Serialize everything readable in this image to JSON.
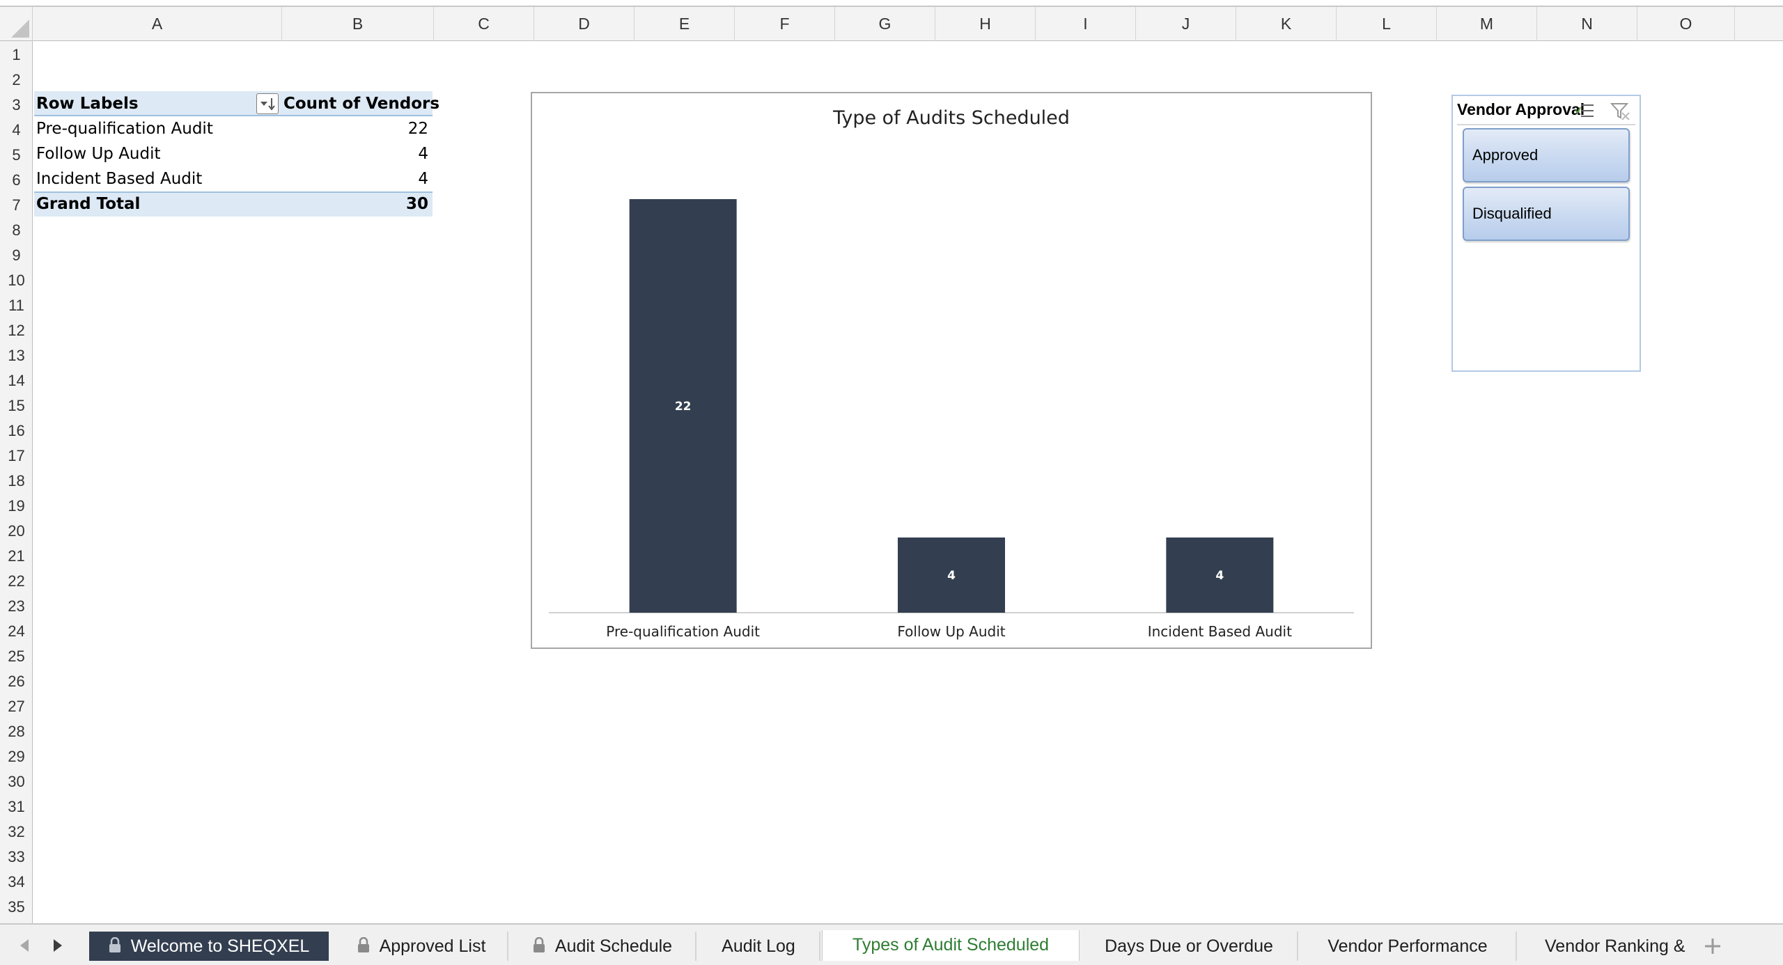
{
  "columns": [
    "A",
    "B",
    "C",
    "D",
    "E",
    "F",
    "G",
    "H",
    "I",
    "J",
    "K",
    "L",
    "M",
    "N",
    "O"
  ],
  "rows": [
    "1",
    "2",
    "3",
    "4",
    "5",
    "6",
    "7",
    "8",
    "9",
    "10",
    "11",
    "12",
    "13",
    "14",
    "15",
    "16",
    "17",
    "18",
    "19",
    "20",
    "21",
    "22",
    "23",
    "24",
    "25",
    "26",
    "27",
    "28",
    "29",
    "30",
    "31",
    "32",
    "33",
    "34",
    "35"
  ],
  "pivot": {
    "header_label": "Row Labels",
    "header_value": "Count of Vendors",
    "rows": [
      {
        "label": "Pre-qualification Audit",
        "value": "22"
      },
      {
        "label": "Follow Up Audit",
        "value": "4"
      },
      {
        "label": "Incident Based Audit",
        "value": "4"
      }
    ],
    "total_label": "Grand Total",
    "total_value": "30",
    "filter_icon": "sort-filter-dropdown-icon"
  },
  "chart_data": {
    "type": "bar",
    "title": "Type of Audits Scheduled",
    "categories": [
      "Pre-qualification Audit",
      "Follow Up Audit",
      "Incident Based Audit"
    ],
    "values": [
      22,
      4,
      4
    ],
    "data_labels": [
      "22",
      "4",
      "4"
    ],
    "ylim": [
      0,
      24
    ],
    "grid": false,
    "legend": "none",
    "bar_color": "#333f50"
  },
  "slicer": {
    "title": "Vendor Approval",
    "items": [
      "Approved",
      "Disqualified"
    ],
    "multi_select_icon": "multi-select-icon",
    "clear_filter_icon": "clear-filter-icon"
  },
  "tabs": [
    {
      "label": "Welcome to SHEQXEL",
      "locked": true,
      "style": "dark"
    },
    {
      "label": "Approved List",
      "locked": true,
      "style": "normal"
    },
    {
      "label": "Audit Schedule",
      "locked": true,
      "style": "normal"
    },
    {
      "label": "Audit Log",
      "locked": false,
      "style": "normal"
    },
    {
      "label": "Types of Audit Scheduled",
      "locked": false,
      "style": "active"
    },
    {
      "label": "Days Due or Overdue",
      "locked": false,
      "style": "normal"
    },
    {
      "label": "Vendor Performance",
      "locked": false,
      "style": "normal"
    },
    {
      "label": "Vendor Ranking &",
      "locked": false,
      "style": "normal"
    }
  ],
  "colors": {
    "active_tab_text": "#2e7d32",
    "dark_tab_bg": "#333f50",
    "pivot_header_bg": "#dde9f5",
    "slicer_item_border": "#7f9fca"
  }
}
